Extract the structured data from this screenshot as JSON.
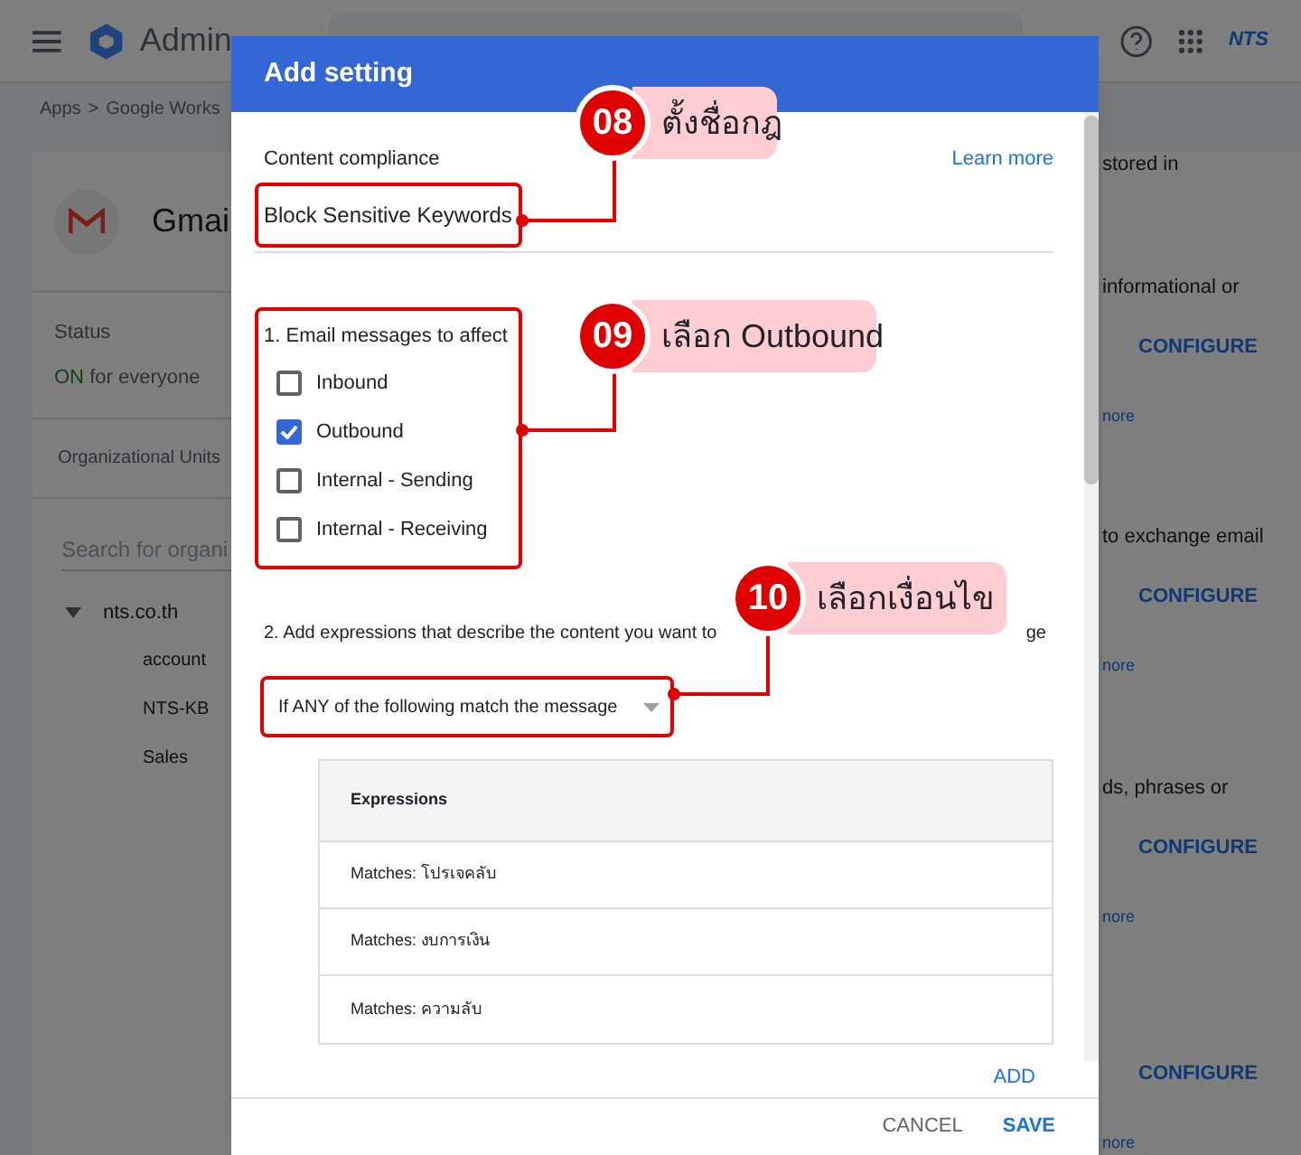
{
  "topbar": {
    "product": "Admin",
    "logo_text": "NTS"
  },
  "breadcrumb": [
    "Apps",
    ">",
    "Google Works"
  ],
  "service": {
    "name": "Gmai",
    "status_label": "Status",
    "status_on": "ON",
    "status_rest": "for everyone",
    "ou_tab": "Organizational Units",
    "ou_search_placeholder": "Search for organi",
    "tree": [
      {
        "label": "nts.co.th",
        "expanded": true,
        "children": [
          {
            "label": "account"
          },
          {
            "label": "NTS-KB"
          },
          {
            "label": "Sales"
          }
        ]
      }
    ]
  },
  "settings_behind": [
    {
      "kind": "text",
      "text": "stored in"
    },
    {
      "kind": "text",
      "text": "informational or"
    },
    {
      "kind": "button",
      "text": "CONFIGURE"
    },
    {
      "kind": "link",
      "text": "nore"
    },
    {
      "kind": "text",
      "text": "to exchange email"
    },
    {
      "kind": "button",
      "text": "CONFIGURE"
    },
    {
      "kind": "link",
      "text": "nore"
    },
    {
      "kind": "text",
      "text": "ds, phrases or"
    },
    {
      "kind": "button",
      "text": "CONFIGURE"
    },
    {
      "kind": "link",
      "text": "nore"
    },
    {
      "kind": "button",
      "text": "CONFIGURE"
    },
    {
      "kind": "link",
      "text": "nore"
    }
  ],
  "dialog": {
    "title": "Add setting",
    "section_label": "Content compliance",
    "learn_more": "Learn more",
    "name_value": "Block Sensitive Keywords",
    "affect_heading": "1. Email messages to affect",
    "affect_options": [
      {
        "label": "Inbound",
        "checked": false
      },
      {
        "label": "Outbound",
        "checked": true
      },
      {
        "label": "Internal - Sending",
        "checked": false
      },
      {
        "label": "Internal - Receiving",
        "checked": false
      }
    ],
    "expressions_heading": "2. Add expressions that describe the content you want to",
    "expressions_heading_end": "ge",
    "match_mode": "If ANY of the following match the message",
    "table": {
      "columns": [
        "Expressions"
      ],
      "rows": [
        "Matches: โปรเจคลับ",
        "Matches: งบการเงิน",
        "Matches: ความลับ"
      ]
    },
    "add": "ADD",
    "buttons": [
      "CANCEL",
      "SAVE"
    ]
  },
  "callouts": [
    {
      "number": "08",
      "text": "ตั้งชื่อกฎ"
    },
    {
      "number": "09",
      "text": "เลือก Outbound"
    },
    {
      "number": "10",
      "text": "เลือกเงื่อนไข"
    }
  ]
}
